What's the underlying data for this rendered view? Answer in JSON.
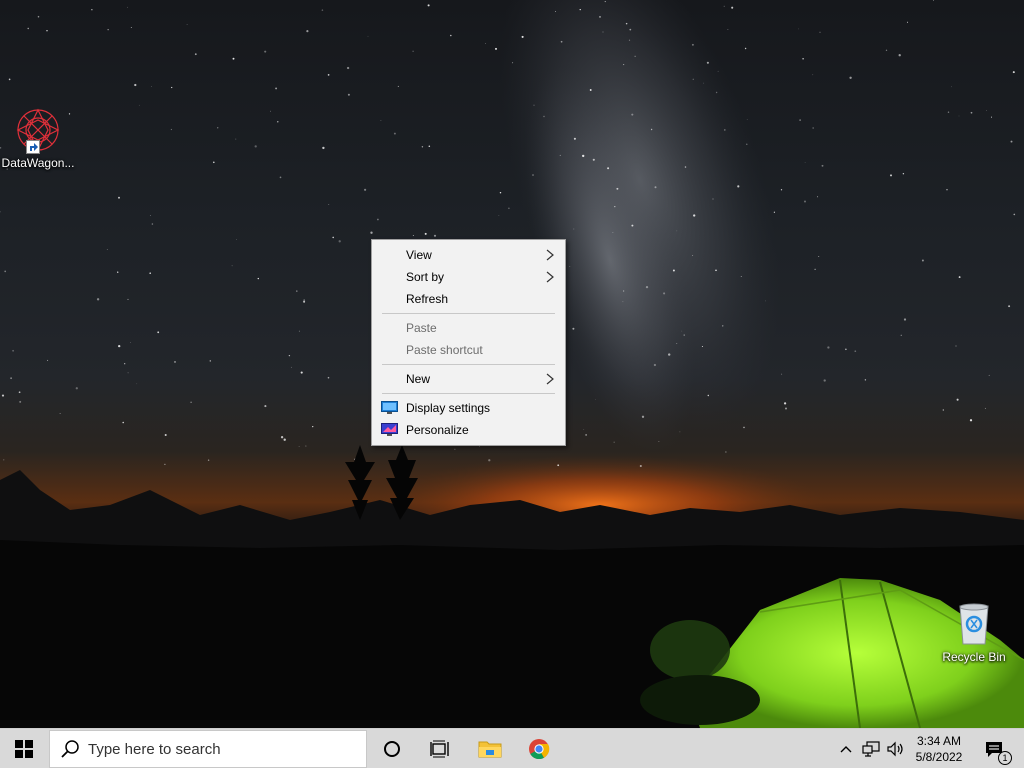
{
  "desktop": {
    "icons": [
      {
        "label": "DataWagon...",
        "icon": "datawagon-app-icon"
      },
      {
        "label": "Recycle Bin",
        "icon": "recycle-bin-icon"
      }
    ]
  },
  "context_menu": {
    "items": [
      {
        "label": "View",
        "submenu": true,
        "enabled": true
      },
      {
        "label": "Sort by",
        "submenu": true,
        "enabled": true
      },
      {
        "label": "Refresh",
        "submenu": false,
        "enabled": true
      },
      {
        "label": "Paste",
        "submenu": false,
        "enabled": false
      },
      {
        "label": "Paste shortcut",
        "submenu": false,
        "enabled": false
      },
      {
        "label": "New",
        "submenu": true,
        "enabled": true
      },
      {
        "label": "Display settings",
        "icon": "display-settings-icon",
        "enabled": true
      },
      {
        "label": "Personalize",
        "icon": "personalize-icon",
        "enabled": true
      }
    ]
  },
  "taskbar": {
    "search_placeholder": "Type here to search",
    "clock_time": "3:34 AM",
    "clock_date": "5/8/2022",
    "notification_count": "1"
  },
  "colors": {
    "taskbar_bg": "#d9d9d9",
    "menu_bg": "#f2f2f2",
    "disabled_text": "#6d6d6d",
    "windows_blue": "#0078d7",
    "tent_green": "#8ee02a"
  }
}
